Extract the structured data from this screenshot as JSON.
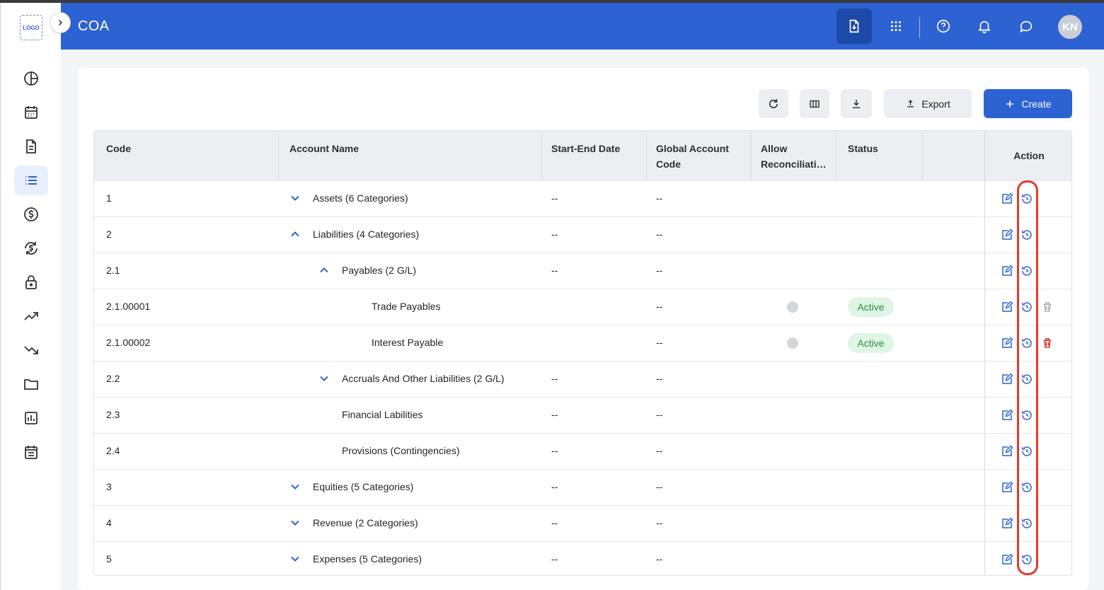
{
  "app": {
    "logo_text": "LOGO",
    "title": "COA"
  },
  "colors": {
    "brand": "#2d62d2",
    "active_badge_bg": "#def6e3",
    "active_badge_text": "#2e8b45",
    "delete_red": "#d93025",
    "highlight": "#e03b30"
  },
  "sidebar": {
    "items": [
      {
        "icon": "pie-chart-icon"
      },
      {
        "icon": "calendar-icon"
      },
      {
        "icon": "document-icon"
      },
      {
        "icon": "list-icon",
        "active": true
      },
      {
        "icon": "dollar-icon"
      },
      {
        "icon": "currency-exchange-icon"
      },
      {
        "icon": "lock-icon"
      },
      {
        "icon": "trending-up-icon"
      },
      {
        "icon": "trending-down-icon"
      },
      {
        "icon": "folder-icon"
      },
      {
        "icon": "bar-chart-icon"
      },
      {
        "icon": "notes-icon"
      }
    ]
  },
  "header": {
    "icons": [
      "file-download-icon",
      "apps-grid-icon",
      "help-icon",
      "bell-icon",
      "chat-icon"
    ],
    "avatar_initials": "KN"
  },
  "toolbar": {
    "export_label": "Export",
    "create_label": "Create"
  },
  "table": {
    "columns": {
      "code": "Code",
      "account_name": "Account Name",
      "start_end_date": "Start-End Date",
      "global_code_1": "Global Account",
      "global_code_2": "Code",
      "allow_1": "Allow",
      "allow_2": "Reconciliati…",
      "status": "Status",
      "action": "Action"
    },
    "rows": [
      {
        "code": "1",
        "name": "Assets (6 Categories)",
        "date": "--",
        "global": "--",
        "chevron": "down"
      },
      {
        "code": "2",
        "name": "Liabilities (4 Categories)",
        "date": "--",
        "global": "--",
        "chevron": "up"
      },
      {
        "code": "2.1",
        "name": "Payables (2 G/L)",
        "date": "--",
        "global": "--",
        "chevron": "up"
      },
      {
        "code": "2.1.00001",
        "name": "Trade Payables",
        "date": "",
        "global": "--",
        "status": "Active",
        "delete": "gray"
      },
      {
        "code": "2.1.00002",
        "name": "Interest Payable",
        "date": "",
        "global": "--",
        "status": "Active",
        "delete": "red"
      },
      {
        "code": "2.2",
        "name": "Accruals And Other Liabilities (2 G/L)",
        "date": "--",
        "global": "--",
        "chevron": "down"
      },
      {
        "code": "2.3",
        "name": "Financial Labilities",
        "date": "--",
        "global": "--"
      },
      {
        "code": "2.4",
        "name": "Provisions (Contingencies)",
        "date": "--",
        "global": "--"
      },
      {
        "code": "3",
        "name": "Equities (5 Categories)",
        "date": "--",
        "global": "--",
        "chevron": "down"
      },
      {
        "code": "4",
        "name": "Revenue (2 Categories)",
        "date": "--",
        "global": "--",
        "chevron": "down"
      },
      {
        "code": "5",
        "name": "Expenses (5 Categories)",
        "date": "--",
        "global": "--",
        "chevron": "down"
      }
    ]
  }
}
